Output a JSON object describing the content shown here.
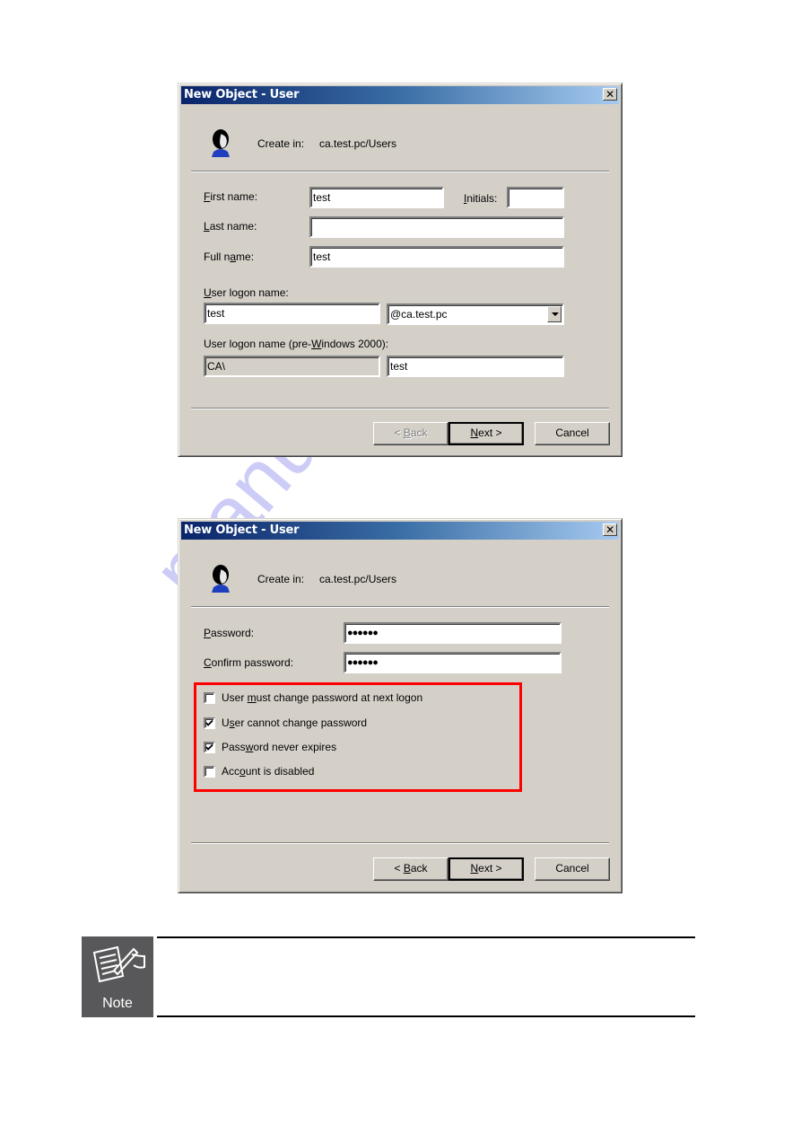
{
  "dialog1": {
    "title": "New Object - User",
    "close_glyph": "✕",
    "create_in_label": "Create in:",
    "create_in_value": "ca.test.pc/Users",
    "first_name": {
      "label_pre": "",
      "label_u": "F",
      "label_post": "irst name:",
      "value": "test"
    },
    "initials": {
      "label_u": "I",
      "label_post": "nitials:",
      "value": ""
    },
    "last_name": {
      "label_u": "L",
      "label_post": "ast name:",
      "value": ""
    },
    "full_name": {
      "label_pre": "Full n",
      "label_u": "a",
      "label_post": "me:",
      "value": "test"
    },
    "logon_name": {
      "label_u": "U",
      "label_post": "ser logon name:",
      "value": "test",
      "domain": "@ca.test.pc"
    },
    "pre2000": {
      "label_pre": "User logon name (pre-",
      "label_u": "W",
      "label_post": "indows 2000):",
      "domain_value": "CA\\",
      "value": "test"
    },
    "buttons": {
      "back": {
        "pre": "< ",
        "u": "B",
        "post": "ack",
        "enabled": false
      },
      "next": {
        "pre": "",
        "u": "N",
        "post": "ext >"
      },
      "cancel": "Cancel"
    }
  },
  "dialog2": {
    "title": "New Object - User",
    "close_glyph": "✕",
    "create_in_label": "Create in:",
    "create_in_value": "ca.test.pc/Users",
    "password": {
      "label_u": "P",
      "label_post": "assword:",
      "value": "●●●●●●"
    },
    "confirm": {
      "label_u": "C",
      "label_post": "onfirm password:",
      "value": "●●●●●●"
    },
    "options": [
      {
        "pre": "User ",
        "u": "m",
        "post": "ust change password at next logon",
        "checked": false
      },
      {
        "pre": "U",
        "u": "s",
        "post": "er cannot change password",
        "checked": true
      },
      {
        "pre": "Pass",
        "u": "w",
        "post": "ord never expires",
        "checked": true
      },
      {
        "pre": "Acc",
        "u": "o",
        "post": "unt is disabled",
        "checked": false
      }
    ],
    "highlight_color": "#ff0000",
    "buttons": {
      "back": {
        "pre": "< ",
        "u": "B",
        "post": "ack",
        "enabled": true
      },
      "next": {
        "pre": "",
        "u": "N",
        "post": "ext >"
      },
      "cancel": "Cancel"
    }
  },
  "note": {
    "icon": "note-pencil-icon",
    "label": "Note",
    "text": ""
  },
  "watermark": "manualshive.com"
}
